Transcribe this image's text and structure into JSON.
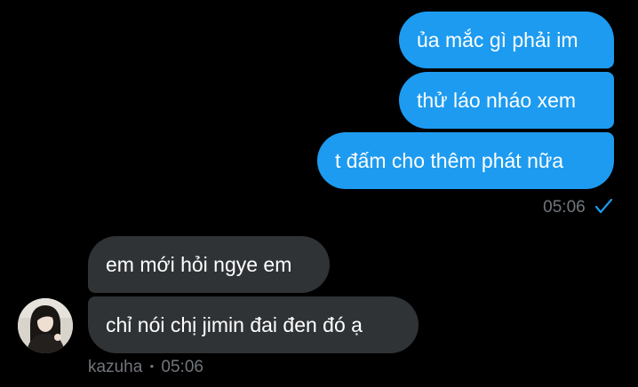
{
  "conversation": {
    "sent_messages": [
      {
        "text": "ủa mắc gì phải im"
      },
      {
        "text": "thử láo nháo xem"
      },
      {
        "text": "t đấm cho thêm phát nữa"
      }
    ],
    "sent_time": "05:06",
    "sent_status_icon": "checkmark-icon",
    "received_messages": [
      {
        "text": "em mới hỏi ngye em"
      },
      {
        "text": "chỉ nói chị jimin đai đen đó ạ"
      }
    ],
    "received_sender": "kazuha",
    "received_separator": "•",
    "received_time": "05:06"
  },
  "colors": {
    "background": "#000000",
    "sent_bubble": "#1d9bf0",
    "received_bubble": "#2f3336",
    "meta_text": "#71767b",
    "read_check": "#1d9bf0"
  }
}
